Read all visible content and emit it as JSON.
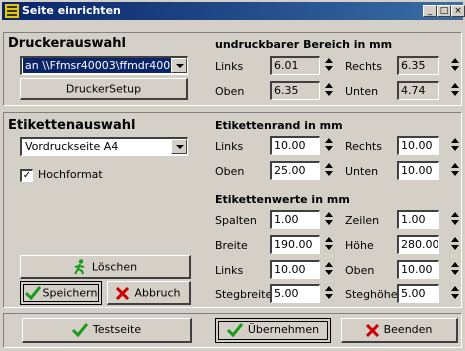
{
  "window": {
    "title": "Seite einrichten",
    "controls": [
      "_",
      "□",
      "×"
    ]
  },
  "drucker": {
    "heading": "Druckerauswahl",
    "printer": "an \\\\Ffmsr40003\\ffmdr40014",
    "setup_button": "DruckerSetup"
  },
  "undruckbar": {
    "heading": "undruckbarer Bereich in mm",
    "links_label": "Links",
    "links": "6.01",
    "rechts_label": "Rechts",
    "rechts": "6.35",
    "oben_label": "Oben",
    "oben": "6.35",
    "unten_label": "Unten",
    "unten": "4.74"
  },
  "etiketten": {
    "heading": "Etikettenauswahl",
    "selected": "Vordruckseite A4",
    "hochformat_label": "Hochformat",
    "hochformat_checked": true,
    "loeschen_button": "Löschen",
    "speichern_button": "Speichern",
    "abbruch_button": "Abbruch"
  },
  "rand": {
    "heading": "Etikettenrand in mm",
    "links_label": "Links",
    "links": "10.00",
    "rechts_label": "Rechts",
    "rechts": "10.00",
    "oben_label": "Oben",
    "oben": "25.00",
    "unten_label": "Unten",
    "unten": "10.00"
  },
  "werte": {
    "heading": "Etikettenwerte in mm",
    "spalten_label": "Spalten",
    "spalten": "1.00",
    "zeilen_label": "Zeilen",
    "zeilen": "1.00",
    "breite_label": "Breite",
    "breite": "190.00",
    "hoehe_label": "Höhe",
    "hoehe": "280.00",
    "links_label": "Links",
    "links": "10.00",
    "oben_label": "Oben",
    "oben": "10.00",
    "stegbreite_label": "Stegbreite",
    "stegbreite": "5.00",
    "steghoehe_label": "Steghöhe",
    "steghoehe": "5.00"
  },
  "footer": {
    "testseite_button": "Testseite",
    "uebernehmen_button": "Übernehmen",
    "beenden_button": "Beenden"
  },
  "colors": {
    "titlebar": "#08246b",
    "check_green": "#1a9a1a",
    "cross_red": "#cc0000",
    "selection": "#0a246a"
  }
}
